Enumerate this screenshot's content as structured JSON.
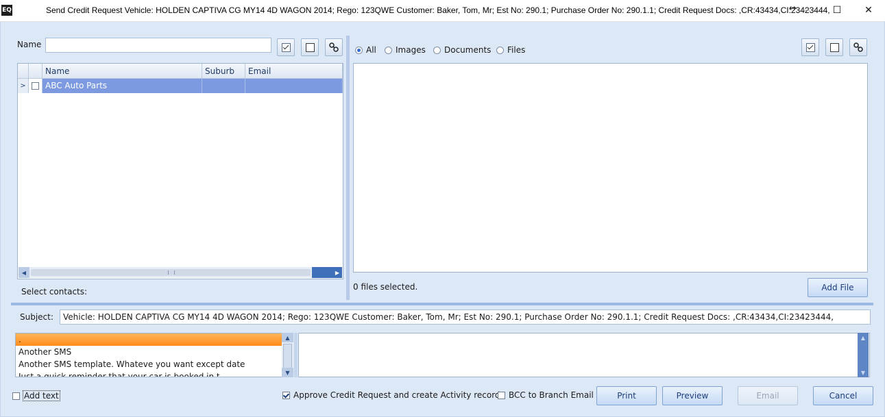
{
  "window": {
    "logo": "EQ",
    "title": "Send Credit Request  Vehicle: HOLDEN CAPTIVA CG MY14 4D WAGON 2014; Rego: 123QWE Customer: Baker, Tom, Mr; Est No: 290.1; Purchase Order No: 290.1.1; Credit Request Docs: ,CR:43434,CI:23423444,",
    "resize_glyph": "↔",
    "minimize": "—",
    "maximize": "☐",
    "close": "✕"
  },
  "contacts": {
    "name_label": "Name",
    "name_value": "",
    "columns": [
      "Name",
      "Suburb",
      "Email"
    ],
    "rows": [
      {
        "name": "ABC Auto Parts",
        "suburb": "",
        "email": "",
        "checked": false,
        "selected": true
      }
    ],
    "select_label": "Select contacts:"
  },
  "files": {
    "filter_options": [
      "All",
      "Images",
      "Documents",
      "Files"
    ],
    "selected_filter": "All",
    "status": "0 files selected.",
    "add_file_label": "Add File"
  },
  "subject": {
    "label": "Subject:",
    "value": "Vehicle: HOLDEN CAPTIVA CG MY14 4D WAGON 2014; Rego: 123QWE Customer: Baker, Tom, Mr; Est No: 290.1; Purchase Order No: 290.1.1; Credit Request Docs: ,CR:43434,CI:23423444,"
  },
  "templates": {
    "items": [
      ".",
      "Another SMS",
      "Another SMS template. Whateve you want except date",
      "Just a quick reminder that your car is booked in t..."
    ]
  },
  "footer": {
    "add_text_label": "Add text",
    "add_text_checked": false,
    "approve_label": "Approve Credit Request and create Activity record",
    "approve_checked": true,
    "bcc_label": "BCC to Branch Email",
    "bcc_checked": false,
    "print_label": "Print",
    "preview_label": "Preview",
    "email_label": "Email",
    "cancel_label": "Cancel"
  },
  "colors": {
    "background": "#dde8f6",
    "selected_row": "#7d9ae0",
    "selected_template": "#ff9a2e",
    "splitter": "#9bbbe6"
  },
  "icons": [
    "check-all-icon",
    "uncheck-all-icon",
    "link-icon",
    "expand-row-icon",
    "scroll-left-icon",
    "scroll-right-icon",
    "scroll-up-icon",
    "scroll-down-icon"
  ]
}
